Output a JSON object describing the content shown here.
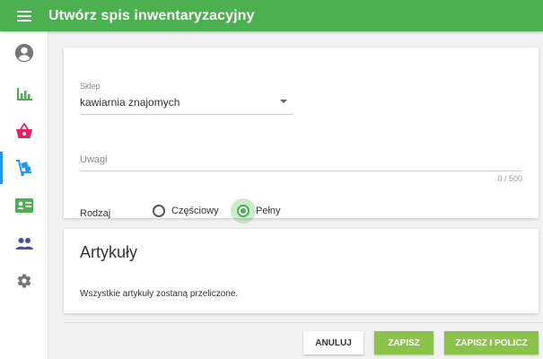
{
  "app": {
    "title": "Utwórz spis inwentaryzacyjny"
  },
  "colors": {
    "topbar": "#4caf50",
    "accent": "#8bc34a",
    "nav_active_indicator": "#2196f3"
  },
  "sidebar": {
    "items": [
      {
        "icon": "account-circle-icon",
        "color": "#757575",
        "active": false
      },
      {
        "icon": "bar-chart-icon",
        "color": "#4caf50",
        "active": false
      },
      {
        "icon": "shopping-basket-icon",
        "color": "#e91e63",
        "active": false
      },
      {
        "icon": "dolly-cart-icon",
        "color": "#2196f3",
        "active": true
      },
      {
        "icon": "contact-card-icon",
        "color": "#4caf50",
        "active": false
      },
      {
        "icon": "people-icon",
        "color": "#3f51b5",
        "active": false
      },
      {
        "icon": "settings-gear-icon",
        "color": "#757575",
        "active": false
      }
    ]
  },
  "form": {
    "shop_label": "Sklep",
    "shop_value": "kawiarnia znajomych",
    "notes_placeholder": "Uwagi",
    "notes_counter": "0 / 500",
    "type_label": "Rodzaj",
    "options": [
      {
        "label": "Częściowy",
        "selected": false
      },
      {
        "label": "Pełny",
        "selected": true
      }
    ]
  },
  "articles": {
    "title": "Artykuły",
    "description": "Wszystkie artykuły zostaną przeliczone."
  },
  "actions": {
    "cancel": "ANULUJ",
    "save": "ZAPISZ",
    "save_and_count": "ZAPISZ I POLICZ"
  }
}
